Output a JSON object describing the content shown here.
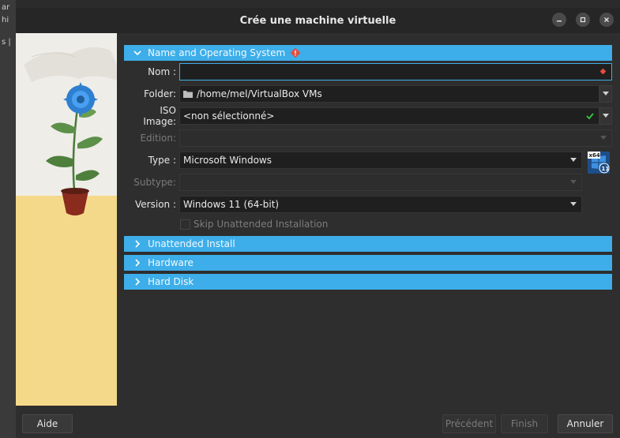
{
  "window": {
    "title": "Crée une machine virtuelle"
  },
  "background": {
    "snippets": [
      "ar",
      "hi",
      "s |"
    ]
  },
  "sections": {
    "name_os": {
      "label": "Name and Operating System"
    },
    "unattended": {
      "label": "Unattended Install"
    },
    "hardware": {
      "label": "Hardware"
    },
    "harddisk": {
      "label": "Hard Disk"
    }
  },
  "form": {
    "nom": {
      "label": "Nom :",
      "value": ""
    },
    "folder": {
      "label": "Folder:",
      "value": "/home/mel/VirtualBox VMs"
    },
    "iso": {
      "label": "ISO Image:",
      "value": "<non sélectionné>"
    },
    "edition": {
      "label": "Edition:",
      "value": ""
    },
    "type": {
      "label": "Type :",
      "value": "Microsoft Windows"
    },
    "subtype": {
      "label": "Subtype:",
      "value": ""
    },
    "version": {
      "label": "Version :",
      "value": "Windows 11 (64-bit)"
    },
    "skip": {
      "label": "Skip Unattended Installation",
      "checked": false
    }
  },
  "os_logo": {
    "top": "x64",
    "bottom": "11"
  },
  "buttons": {
    "help": "Aide",
    "previous": "Précédent",
    "finish": "Finish",
    "cancel": "Annuler"
  },
  "colors": {
    "accent": "#3daee9",
    "warning": "#e74c3c",
    "valid": "#2ecc40"
  }
}
